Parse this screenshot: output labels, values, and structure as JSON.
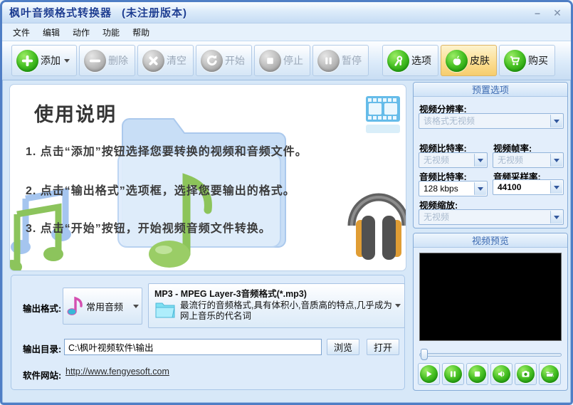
{
  "window": {
    "title": "枫叶音频格式转换器",
    "badge": "(未注册版本)",
    "minimize_glyph": "–",
    "close_glyph": "✕"
  },
  "menu": {
    "items": [
      "文件",
      "编辑",
      "动作",
      "功能",
      "帮助"
    ]
  },
  "toolbar": {
    "buttons": [
      {
        "label": "添加",
        "icon": "plus",
        "enabled": true,
        "dropdown": true
      },
      {
        "label": "删除",
        "icon": "minus",
        "enabled": false
      },
      {
        "label": "清空",
        "icon": "cross",
        "enabled": false
      },
      {
        "label": "开始",
        "icon": "restart-arrow",
        "enabled": false
      },
      {
        "label": "停止",
        "icon": "stop-square",
        "enabled": false
      },
      {
        "label": "暂停",
        "icon": "pause-bars",
        "enabled": false
      },
      {
        "label": "选项",
        "icon": "tools",
        "enabled": true
      },
      {
        "label": "皮肤",
        "icon": "apple",
        "enabled": true,
        "active": true
      },
      {
        "label": "购买",
        "icon": "cart",
        "enabled": true
      }
    ]
  },
  "instructions": {
    "title": "使用说明",
    "steps": [
      "1. 点击“添加”按钮选择您要转换的视频和音频文件。",
      "2. 点击“输出格式”选项框，选择您要输出的格式。",
      "3. 点击“开始”按钮，开始视频音频文件转换。"
    ]
  },
  "preset": {
    "title": "预置选项",
    "video_resolution_label": "视频分辨率:",
    "video_resolution_value": "该格式无视频",
    "video_bitrate_label": "视频比特率:",
    "video_bitrate_value": "无视频",
    "video_framerate_label": "视频帧率:",
    "video_framerate_value": "无视频",
    "audio_bitrate_label": "音频比特率:",
    "audio_bitrate_value": "128 kbps",
    "audio_samplerate_label": "音频采样率:",
    "audio_samplerate_value": "44100",
    "video_scale_label": "视频缩放:",
    "video_scale_value": "无视频"
  },
  "preview": {
    "title": "视频预览"
  },
  "output": {
    "format_label": "输出格式:",
    "category_value": "常用音频",
    "format_title": "MP3 - MPEG Layer-3音频格式(*.mp3)",
    "format_desc_line1": "最流行的音频格式,具有体积小,音质高的特点,几乎成为",
    "format_desc_line2": "网上音乐的代名词",
    "dir_label": "输出目录:",
    "dir_value": "C:\\枫叶视频软件\\输出",
    "browse_label": "浏览",
    "open_label": "打开",
    "site_label": "软件网站:",
    "site_url": "http://www.fengyesoft.com"
  },
  "colors": {
    "accent_green": "#2ca012",
    "skin_button_highlight": "#f8d98c",
    "titlebar_text": "#1c3d92",
    "window_border": "#4f7ec5",
    "groupbox_title": "#3a68b0"
  }
}
